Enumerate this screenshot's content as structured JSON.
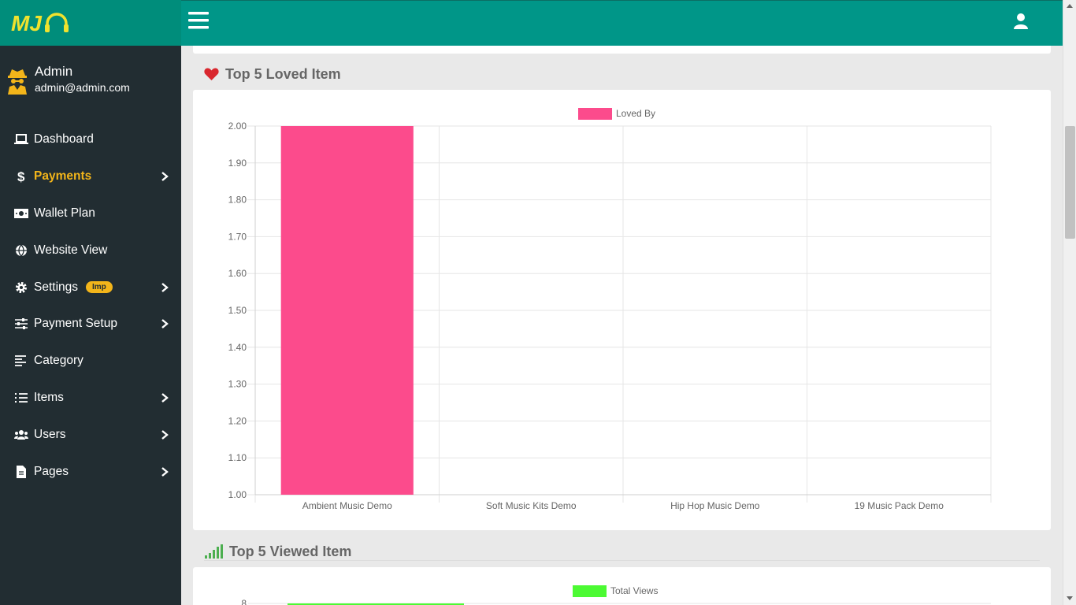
{
  "brand": {
    "logo_text": "MJ"
  },
  "user": {
    "name": "Admin",
    "email": "admin@admin.com"
  },
  "sidebar": {
    "items": [
      {
        "label": "Dashboard",
        "icon": "laptop-icon",
        "active": false,
        "chevron": false
      },
      {
        "label": "Payments",
        "icon": "dollar-icon",
        "active": true,
        "chevron": true
      },
      {
        "label": "Wallet Plan",
        "icon": "money-bill-icon",
        "active": false,
        "chevron": false
      },
      {
        "label": "Website View",
        "icon": "globe-icon",
        "active": false,
        "chevron": false
      },
      {
        "label": "Settings",
        "icon": "gear-icon",
        "active": false,
        "chevron": true,
        "badge": "Imp"
      },
      {
        "label": "Payment Setup",
        "icon": "sliders-icon",
        "active": false,
        "chevron": true
      },
      {
        "label": "Category",
        "icon": "align-left-icon",
        "active": false,
        "chevron": false
      },
      {
        "label": "Items",
        "icon": "list-ol-icon",
        "active": false,
        "chevron": true
      },
      {
        "label": "Users",
        "icon": "users-icon",
        "active": false,
        "chevron": true
      },
      {
        "label": "Pages",
        "icon": "file-icon",
        "active": false,
        "chevron": true
      }
    ]
  },
  "sections": {
    "loved_title": "Top 5 Loved Item",
    "viewed_title": "Top 5 Viewed Item"
  },
  "colors": {
    "sidebar": "#222d32",
    "brand": "#008d7b",
    "header": "#009688",
    "accent": "#f3b51a",
    "loved_bar": "#fc4b8c",
    "views_bar": "#4cfa33",
    "heart": "#d9272e",
    "signal": "#4caf50"
  },
  "chart_data": [
    {
      "type": "bar",
      "legend": "Loved By",
      "categories": [
        "Ambient Music Demo",
        "Soft Music Kits Demo",
        "Hip Hop Music Demo",
        "19 Music Pack Demo"
      ],
      "series": [
        {
          "name": "Loved By",
          "values": [
            2,
            1,
            1,
            1
          ]
        }
      ],
      "ylim": [
        1.0,
        2.0
      ],
      "yticks": [
        "2.00",
        "1.90",
        "1.80",
        "1.70",
        "1.60",
        "1.50",
        "1.40",
        "1.30",
        "1.20",
        "1.10",
        "1.00"
      ],
      "grid": true,
      "legend_position": "top"
    },
    {
      "type": "bar",
      "legend": "Total Views",
      "series": [
        {
          "name": "Total Views",
          "values": [
            8
          ]
        }
      ],
      "yticks": [
        "8"
      ],
      "legend_position": "top"
    }
  ]
}
